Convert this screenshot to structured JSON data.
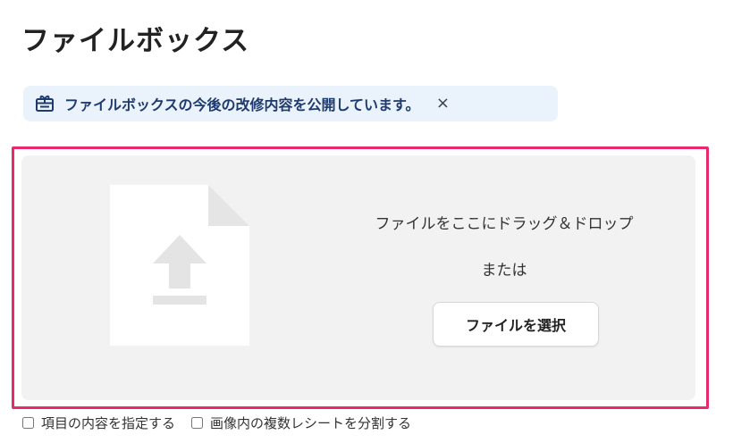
{
  "page": {
    "title": "ファイルボックス"
  },
  "notice": {
    "icon": "calendar-gift-icon",
    "text": "ファイルボックスの今後の改修内容を公開しています。",
    "close_label": "×"
  },
  "dropzone": {
    "icon": "file-upload-icon",
    "drop_text": "ファイルをここにドラッグ＆ドロップ",
    "or_text": "または",
    "select_button_label": "ファイルを選択"
  },
  "options": [
    {
      "label": "項目の内容を指定する",
      "checked": false
    },
    {
      "label": "画像内の複数レシートを分割する",
      "checked": false
    }
  ],
  "colors": {
    "highlight_border": "#e8296e",
    "notice_bg": "#eaf2fb",
    "notice_text": "#1e3a6e",
    "dropzone_bg": "#f3f2f2"
  }
}
